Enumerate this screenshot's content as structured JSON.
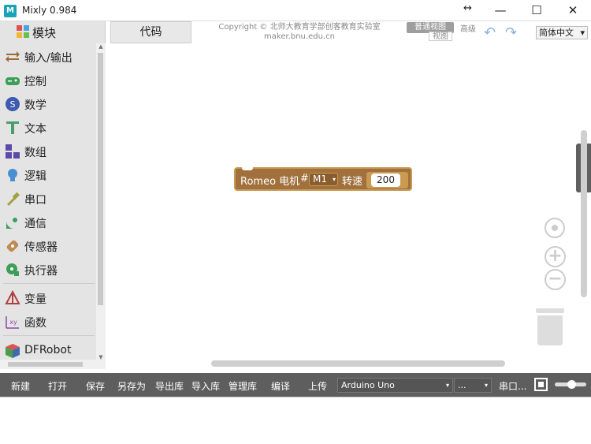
{
  "window": {
    "title": "Mixly 0.984",
    "app_icon_glyph": "M",
    "resize_glyph": "↔",
    "minimize": "—",
    "maximize": "☐",
    "close": "✕"
  },
  "palette": {
    "header_label": "模块",
    "categories": [
      {
        "label": "输入/输出",
        "icon": "io-arrows-icon"
      },
      {
        "label": "控制",
        "icon": "gamepad-icon"
      },
      {
        "label": "数学",
        "icon": "math-icon"
      },
      {
        "label": "文本",
        "icon": "text-t-icon"
      },
      {
        "label": "数组",
        "icon": "array-blocks-icon"
      },
      {
        "label": "逻辑",
        "icon": "lightbulb-icon"
      },
      {
        "label": "串口",
        "icon": "serial-plug-icon"
      },
      {
        "label": "通信",
        "icon": "satellite-dish-icon"
      },
      {
        "label": "传感器",
        "icon": "sensor-icon"
      },
      {
        "label": "执行器",
        "icon": "actuator-icon"
      },
      {
        "label": "变量",
        "icon": "variable-icon"
      },
      {
        "label": "函数",
        "icon": "function-xy-icon"
      },
      {
        "label": "DFRobot",
        "icon": "dfrobot-cube-icon"
      }
    ]
  },
  "header": {
    "code_tab": "代码",
    "copyright_line1": "Copyright © 北师大教育学部创客教育实验室",
    "copyright_line2": "maker.bnu.edu.cn",
    "mode_normal": "普通视图",
    "mode_view": "视图",
    "mode_advanced": "高级",
    "undo": "↶",
    "redo": "↷",
    "language": "简体中文",
    "language_caret": "▾"
  },
  "workspace": {
    "block": {
      "prefix": "Romeo 电机",
      "hash": "#",
      "motor": "M1",
      "speed_label": "转速",
      "speed_value": "200"
    },
    "handle_glyph": "‹",
    "zoom_in": "+",
    "zoom_out": "−"
  },
  "toolbar": {
    "new": "新建",
    "open": "打开",
    "save": "保存",
    "save_as": "另存为",
    "export_lib": "导出库",
    "import_lib": "导入库",
    "manage_lib": "管理库",
    "compile": "编译",
    "upload": "上传",
    "board": "Arduino Uno",
    "port": "...",
    "serial": "串口...",
    "caret": "▾"
  },
  "colors": {
    "block_fill": "#a1703d",
    "block_border": "#c89a52",
    "toolbar_bg": "#5e5e5e",
    "palette_bg": "#e4e4e4"
  }
}
